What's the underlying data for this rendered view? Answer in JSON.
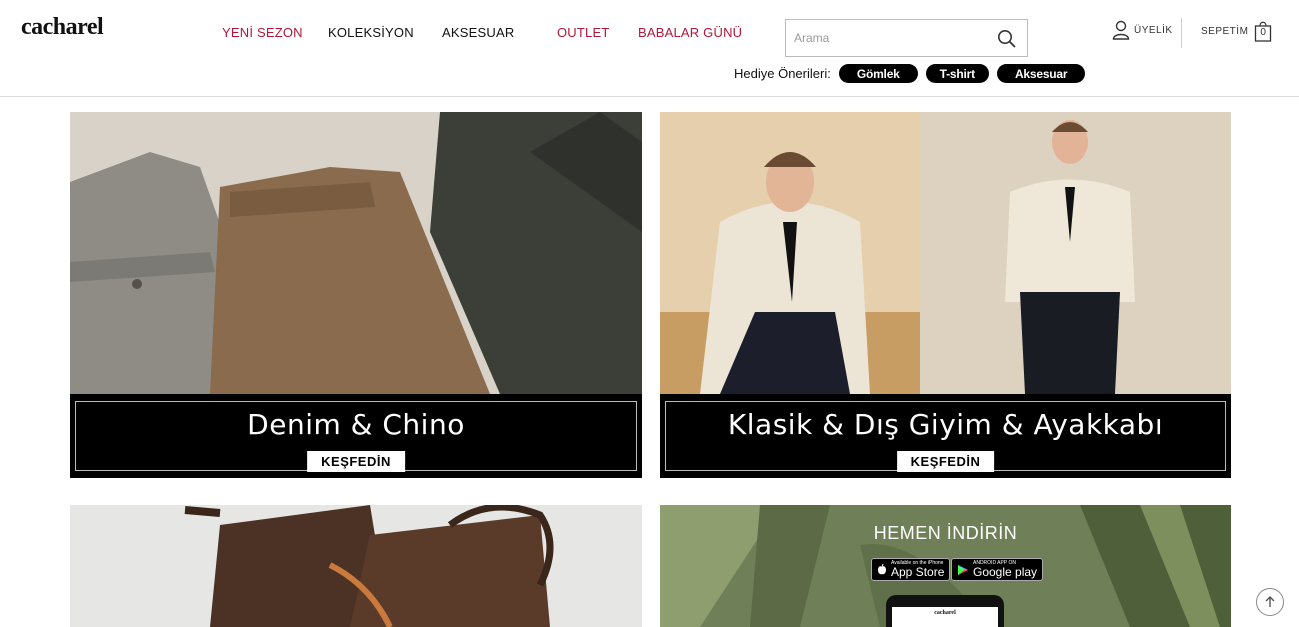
{
  "brand": {
    "logo": "cacharel"
  },
  "nav": {
    "items": [
      {
        "label": "YENİ SEZON",
        "color": "#b0173a"
      },
      {
        "label": "KOLEKSİYON",
        "color": "#111111"
      },
      {
        "label": "AKSESUAR",
        "color": "#111111"
      },
      {
        "label": "OUTLET",
        "color": "#b0173a"
      },
      {
        "label": "BABALAR GÜNÜ",
        "color": "#b0173a"
      }
    ]
  },
  "search": {
    "placeholder": "Arama",
    "icon": "search-icon"
  },
  "account": {
    "label": "ÜYELİK",
    "icon": "user-icon"
  },
  "cart": {
    "label": "SEPETİM",
    "count": "0",
    "icon": "shopping-bag-icon"
  },
  "gifts": {
    "label": "Hediye Önerileri:",
    "items": [
      "Gömlek",
      "T-shirt",
      "Aksesuar"
    ]
  },
  "tiles": [
    {
      "title": "Denim & Chino",
      "button": "KEŞFEDİN"
    },
    {
      "title": "Klasik & Dış Giyim & Ayakkabı",
      "button": "KEŞFEDİN"
    }
  ],
  "app_promo": {
    "title": "HEMEN İNDİRİN",
    "app_store": {
      "small": "Available on the iPhone",
      "big": "App Store"
    },
    "google_play": {
      "small": "ANDROID APP ON",
      "big": "Google play"
    },
    "phone_logo": "cacharel"
  },
  "colors": {
    "accent": "#b0173a",
    "dark": "#000000"
  }
}
